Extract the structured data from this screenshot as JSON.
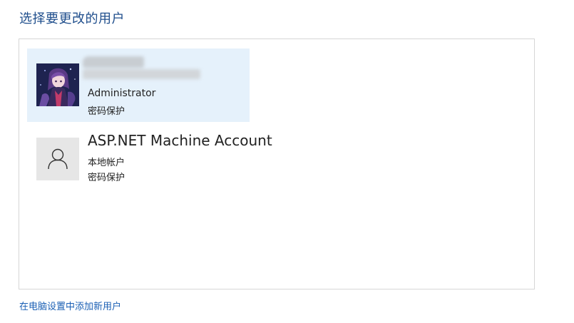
{
  "page": {
    "title": "选择要更改的用户",
    "add_user_link": "在电脑设置中添加新用户"
  },
  "users": [
    {
      "name": "",
      "role": "Administrator",
      "status": "密码保护",
      "avatar": "photo-avatar",
      "selected": true
    },
    {
      "name": "ASP.NET Machine Account",
      "role": "本地帐户",
      "status": "密码保护",
      "avatar": "generic-person-icon",
      "selected": false
    }
  ],
  "colors": {
    "title": "#1f4e8c",
    "link": "#1a5fb4",
    "selected_background": "#e5f1fb",
    "panel_border": "#d6d6d6",
    "generic_avatar_background": "#e6e6e6"
  }
}
